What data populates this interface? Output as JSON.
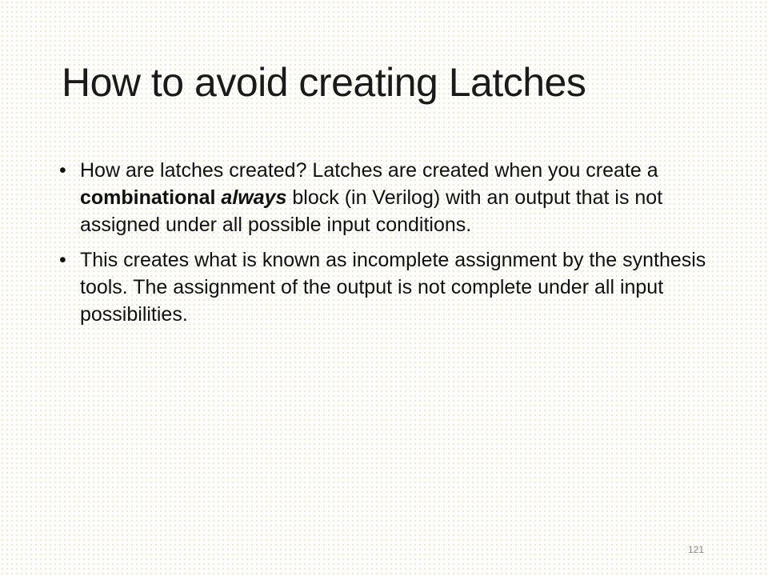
{
  "slide": {
    "title": "How to avoid creating Latches",
    "bullets": [
      {
        "text_1": "How are latches created? Latches are created when you create a ",
        "bold": "combinational",
        "space": " ",
        "bold_italic": "always",
        "text_2": " block (in Verilog) with an output that is not assigned under all possible input conditions."
      },
      {
        "text": "This creates what is known as incomplete assignment by the synthesis tools. The assignment of the output is not complete under all input possibilities."
      }
    ],
    "bullet_glyph": "•",
    "page_number": "121"
  }
}
